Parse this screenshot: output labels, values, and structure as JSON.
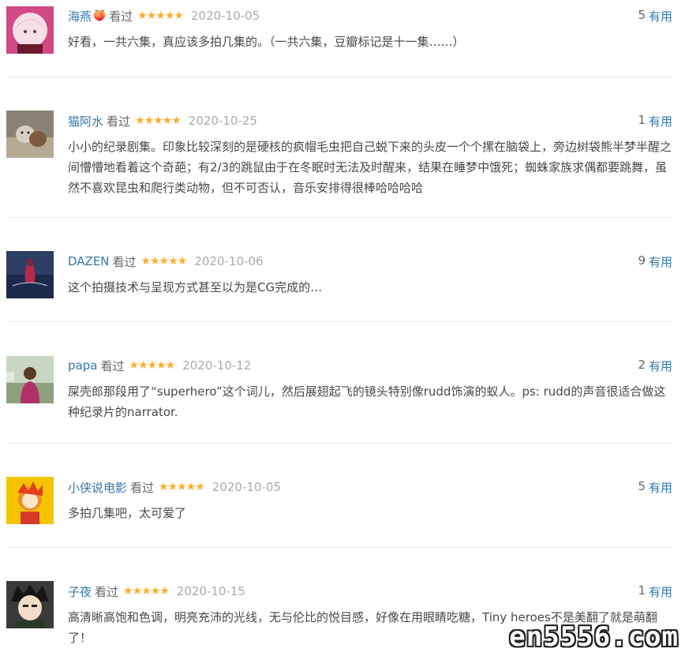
{
  "reviews": [
    {
      "user": "海燕",
      "badge": "🍑",
      "watched": "看过",
      "stars": "★★★★★",
      "date": "2020-10-05",
      "votes": "5",
      "useful": "有用",
      "text": "好看，一共六集，真应该多拍几集的。（一共六集，豆瓣标记是十一集……）"
    },
    {
      "user": "猫阿水",
      "badge": "",
      "watched": "看过",
      "stars": "★★★★★",
      "date": "2020-10-25",
      "votes": "1",
      "useful": "有用",
      "text": "小小的纪录剧集。印象比较深刻的是硬核的疯帽毛虫把自己蜕下来的头皮一个个摞在脑袋上，旁边树袋熊半梦半醒之间懵懵地看着这个奇葩；有2/3的跳鼠由于在冬眠时无法及时醒来，结果在睡梦中饿死；蜘蛛家族求偶都要跳舞，虽然不喜欢昆虫和爬行类动物，但不可否认，音乐安排得很棒哈哈哈哈"
    },
    {
      "user": "DAZEN",
      "badge": "",
      "watched": "看过",
      "stars": "★★★★★",
      "date": "2020-10-06",
      "votes": "9",
      "useful": "有用",
      "text": "这个拍摄技术与呈现方式甚至以为是CG完成的…"
    },
    {
      "user": "papa",
      "badge": "",
      "watched": "看过",
      "stars": "★★★★★",
      "date": "2020-10-12",
      "votes": "2",
      "useful": "有用",
      "text": "屎壳郎那段用了“superhero”这个词儿，然后展翅起飞的镜头特别像rudd饰演的蚁人。ps: rudd的声音很适合做这种纪录片的narrator."
    },
    {
      "user": "小侠说电影",
      "badge": "",
      "watched": "看过",
      "stars": "★★★★★",
      "date": "2020-10-05",
      "votes": "5",
      "useful": "有用",
      "text": "多拍几集吧，太可爱了"
    },
    {
      "user": "子夜",
      "badge": "",
      "watched": "看过",
      "stars": "★★★★★",
      "date": "2020-10-15",
      "votes": "1",
      "useful": "有用",
      "text": "高清晰高饱和色调，明亮充沛的光线，无与伦比的悦目感，好像在用眼睛吃糖，Tiny heroes不是美翻了就是萌翻了！"
    }
  ],
  "watermark": "en5556.com"
}
